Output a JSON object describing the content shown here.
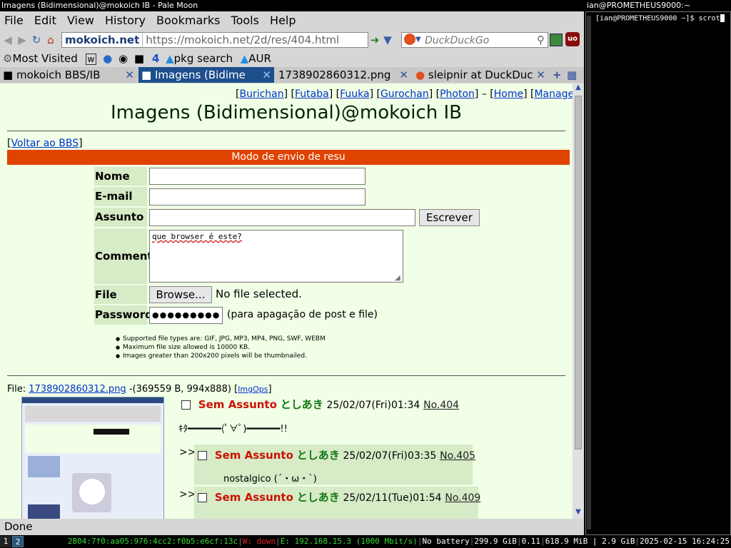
{
  "window": {
    "title": "Imagens (Bidimensional)@mokoich IB - Pale Moon"
  },
  "menu": [
    "File",
    "Edit",
    "View",
    "History",
    "Bookmarks",
    "Tools",
    "Help"
  ],
  "nav": {
    "site_badge": "mokoich.net",
    "url": "https://mokoich.net/2d/res/404.html",
    "search_placeholder": "DuckDuckGo"
  },
  "bookmarks": {
    "most_visited": "Most Visited",
    "num": "4",
    "pkg_search": "pkg search",
    "aur": "AUR"
  },
  "tabs": [
    {
      "label": "mokoich BBS/IB"
    },
    {
      "label": "Imagens (Bidime"
    },
    {
      "label": "1738902860312.png"
    },
    {
      "label": "sleipnir at DuckDuc"
    }
  ],
  "page": {
    "topnav": [
      "Burichan",
      "Futaba",
      "Fuuka",
      "Gurochan",
      "Photon"
    ],
    "home": "Home",
    "manage": "Manage",
    "dash": "–",
    "title": "Imagens (Bidimensional)@mokoich IB",
    "back_link": "Voltar ao BBS",
    "mode_bar": "Modo de envio de resu",
    "form": {
      "name_label": "Nome",
      "email_label": "E-mail",
      "subject_label": "Assunto",
      "submit_label": "Escrever",
      "comment_label": "Comment",
      "comment_value": "que browser é este?",
      "file_label": "File",
      "browse_label": "Browse...",
      "no_file": "No file selected.",
      "password_label": "Password",
      "password_value": "●●●●●●●●●",
      "password_note": "(para apagação de post e file)"
    },
    "rules": [
      "Supported file types are: GIF, JPG, MP3, MP4, PNG, SWF, WEBM",
      "Maximum file size allowed is 10000 KB.",
      "Images greater than 200x200 pixels will be thumbnailed."
    ],
    "op": {
      "file_prefix": "File:",
      "file_name": "1738902860312.png",
      "file_info": "-(369559 B, 994x888)",
      "imgops": "ImgOps",
      "subject": "Sem Assunto",
      "poster": "としあき",
      "date": "25/02/07(Fri)01:34",
      "number": "No.404",
      "body": "ｷﾀ━━━━━━(ﾟ∀ﾟ)━━━━━━!!"
    },
    "replies": [
      {
        "subject": "Sem Assunto",
        "poster": "としあき",
        "date": "25/02/07(Fri)03:35",
        "number": "No.405",
        "body": "nostalgico (´・ω・`)"
      },
      {
        "subject": "Sem Assunto",
        "poster": "としあき",
        "date": "25/02/11(Tue)01:54",
        "number": "No.409",
        "body": ""
      }
    ],
    "reply_marker": ">>"
  },
  "status": "Done",
  "terminal": {
    "title": "ian@PROMETHEUS9000:~",
    "prompt": "[ian@PROMETHEUS9000 ~]$ scrot"
  },
  "bottombar": {
    "ws1": "1",
    "ws2": "2",
    "ipv6": "2804:7f0:aa05:976:4cc2:f0b5:e6cf:13c",
    "wifi": "W: down",
    "eth": "E: 192.168.15.3 (1000 Mbit/s)",
    "battery": "No battery",
    "disk": "299.9 GiB",
    "load": "0.11",
    "mem": "618.9 MiB | 2.9 GiB",
    "datetime": "2025-02-15 16:24:25"
  },
  "colors": {
    "page_bg": "#f0ffe6",
    "mode_bar": "#e04200",
    "active_tab": "#1e4f8c",
    "subject": "#cc1100",
    "poster": "#117711",
    "eth_green": "#33dd33",
    "wifi_red": "#ee2222"
  }
}
